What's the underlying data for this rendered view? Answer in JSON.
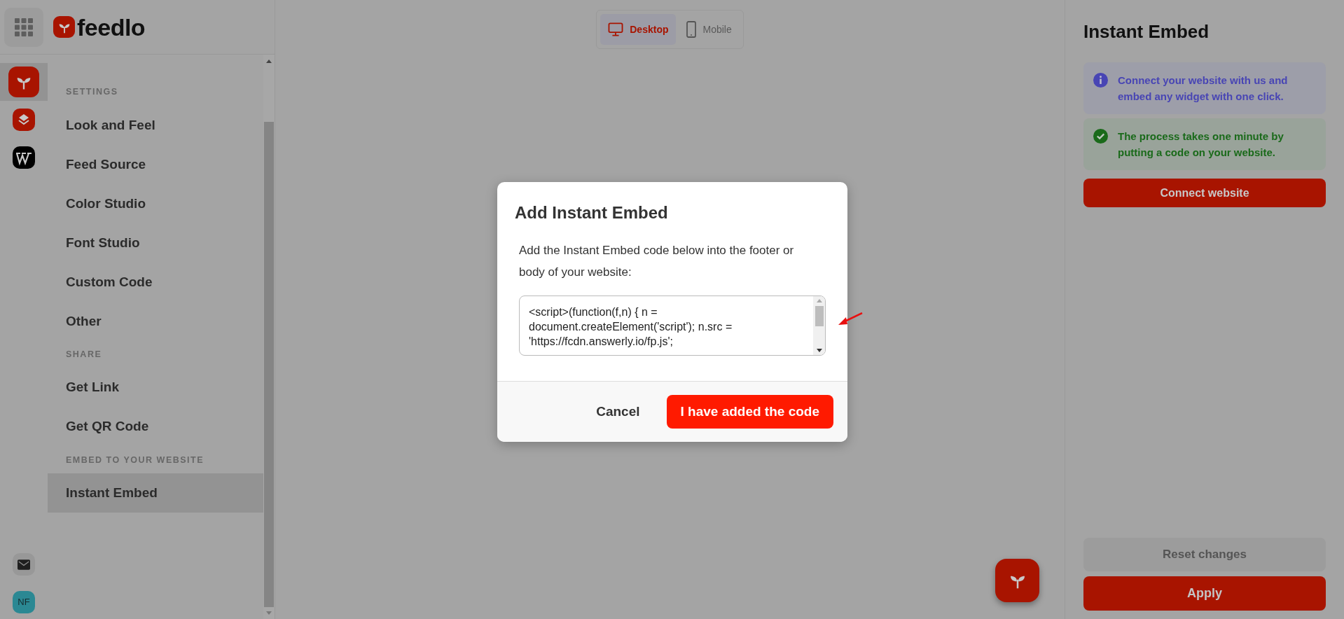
{
  "header": {
    "logo": "feedlo"
  },
  "app_icons": [
    {
      "kind": "feedlo",
      "selected": true
    },
    {
      "kind": "layers",
      "selected": false
    },
    {
      "kind": "wordpress",
      "selected": false
    }
  ],
  "bottom_icons": [
    {
      "kind": "mail"
    },
    {
      "kind": "avatar",
      "text": "NF"
    }
  ],
  "nav_sections": [
    {
      "heading": "SETTINGS",
      "items": [
        {
          "label": "Look and Feel",
          "selected": false
        },
        {
          "label": "Feed Source",
          "selected": false
        },
        {
          "label": "Color Studio",
          "selected": false
        },
        {
          "label": "Font Studio",
          "selected": false
        },
        {
          "label": "Custom Code",
          "selected": false
        },
        {
          "label": "Other",
          "selected": false
        }
      ]
    },
    {
      "heading": "SHARE",
      "items": [
        {
          "label": "Get Link",
          "selected": false
        },
        {
          "label": "Get QR Code",
          "selected": false
        }
      ]
    },
    {
      "heading": "EMBED TO YOUR WEBSITE",
      "items": [
        {
          "label": "Instant Embed",
          "selected": true
        }
      ]
    }
  ],
  "view_toggle": [
    {
      "kind": "desktop",
      "label": "Desktop",
      "selected": true
    },
    {
      "kind": "mobile",
      "label": "Mobile",
      "selected": false
    }
  ],
  "modal": {
    "title": "Add Instant Embed",
    "text": "Add the Instant Embed code below into the footer or body of your website:",
    "code": "<script>(function(f,n) { n = document.createElement('script'); n.src = 'https://fcdn.answerly.io/fp.js';",
    "buttons": [
      {
        "kind": "secondary",
        "label": "Cancel"
      },
      {
        "kind": "primary",
        "label": "I have added the code"
      }
    ]
  },
  "panel": {
    "title": "Instant Embed",
    "notices": [
      {
        "kind": "info",
        "text": "Connect your website with us and embed any widget with one click."
      },
      {
        "kind": "success",
        "text": "The process takes one minute by putting a code on your website."
      }
    ],
    "connect_button": "Connect website",
    "reset_button": "Reset changes",
    "apply_button": "Apply"
  }
}
